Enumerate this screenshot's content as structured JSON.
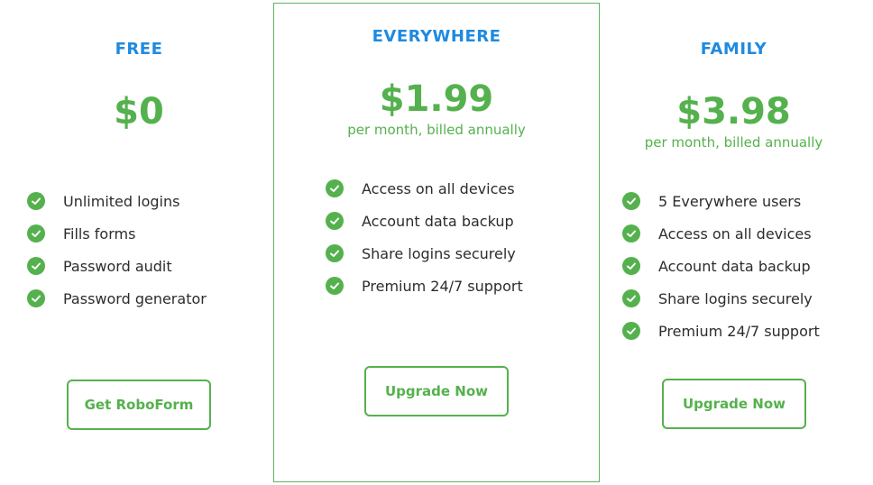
{
  "colors": {
    "plan_name": "#1f8ae0",
    "accent_green": "#55b14d",
    "text": "#2c2c2c",
    "border": "#dcdcdc"
  },
  "plans": [
    {
      "name": "FREE",
      "price": "$0",
      "billing": "",
      "features": [
        "Unlimited logins",
        "Fills forms",
        "Password audit",
        "Password generator"
      ],
      "cta": "Get RoboForm"
    },
    {
      "name": "EVERYWHERE",
      "price": "$1.99",
      "billing": "per month, billed annually",
      "features": [
        "Access on all devices",
        "Account data backup",
        "Share logins securely",
        "Premium 24/7 support"
      ],
      "cta": "Upgrade Now"
    },
    {
      "name": "FAMILY",
      "price": "$3.98",
      "billing": "per month, billed annually",
      "features": [
        "5 Everywhere users",
        "Access on all devices",
        "Account data backup",
        "Share logins securely",
        "Premium 24/7 support"
      ],
      "cta": "Upgrade Now"
    }
  ],
  "icons": {
    "feature_check": "check-circle-icon"
  }
}
